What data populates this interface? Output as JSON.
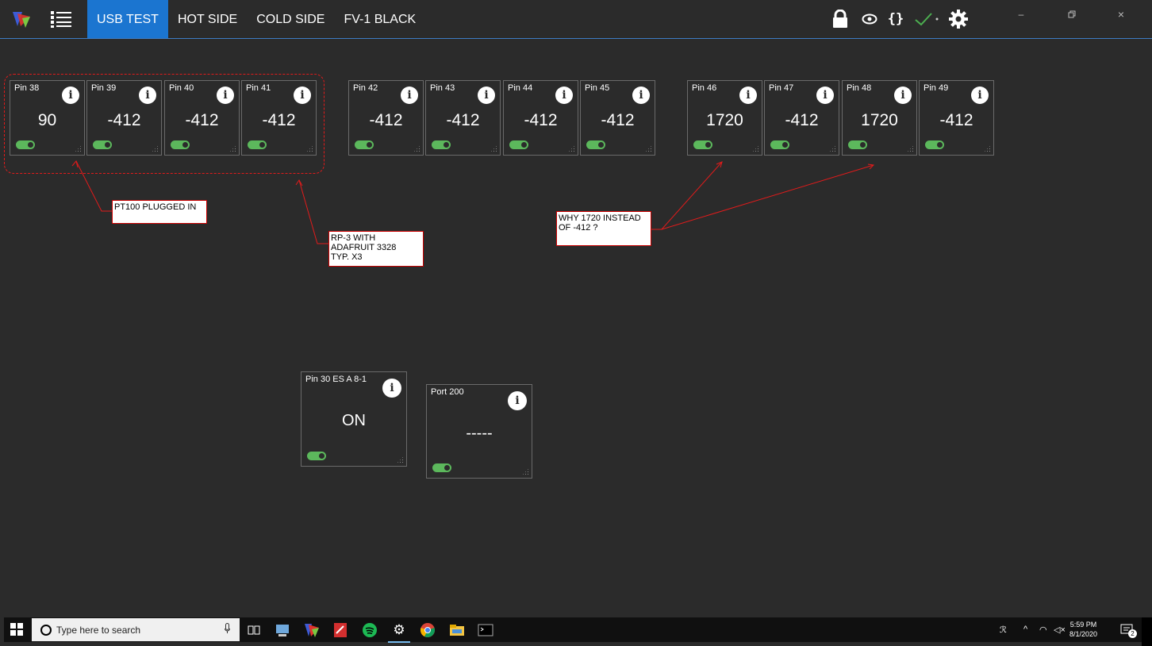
{
  "tabs": [
    {
      "label": "USB TEST",
      "active": true
    },
    {
      "label": "HOT SIDE",
      "active": false
    },
    {
      "label": "COLD SIDE",
      "active": false
    },
    {
      "label": "FV-1 BLACK",
      "active": false
    }
  ],
  "toolbar": {
    "icons": [
      "lock-icon",
      "eye-icon",
      "braces-icon",
      "checkmark-icon",
      "gear-icon"
    ],
    "check_color": "#4caf50"
  },
  "window_controls": [
    "minimize-icon",
    "restore-icon",
    "close-icon"
  ],
  "widgets": [
    {
      "pin": "Pin 38",
      "value": "90"
    },
    {
      "pin": "Pin 39",
      "value": "-412"
    },
    {
      "pin": "Pin 40",
      "value": "-412"
    },
    {
      "pin": "Pin 41",
      "value": "-412"
    },
    {
      "pin": "Pin 42",
      "value": "-412"
    },
    {
      "pin": "Pin 43",
      "value": "-412"
    },
    {
      "pin": "Pin 44",
      "value": "-412"
    },
    {
      "pin": "Pin 45",
      "value": "-412"
    },
    {
      "pin": "Pin 46",
      "value": "1720"
    },
    {
      "pin": "Pin 47",
      "value": "-412"
    },
    {
      "pin": "Pin 48",
      "value": "1720"
    },
    {
      "pin": "Pin 49",
      "value": "-412"
    }
  ],
  "big_widgets": [
    {
      "pin": "Pin 30 ES A 8-1",
      "value": "ON"
    },
    {
      "pin": "Port 200",
      "value": "-----"
    }
  ],
  "notes": {
    "pt100": "PT100 PLUGGED IN",
    "rp3_line1": "RP-3 WITH",
    "rp3_line2": "ADAFRUIT 3328",
    "rp3_line3": "TYP. X3",
    "why_line1": "WHY 1720 INSTEAD",
    "why_line2": "OF -412 ?"
  },
  "annotation_color": "#e21b1b",
  "toggle_color": "#5cb85c",
  "taskbar": {
    "search_placeholder": "Type here to search",
    "time": "5:59 PM",
    "date": "8/1/2020",
    "notification_count": "2"
  }
}
